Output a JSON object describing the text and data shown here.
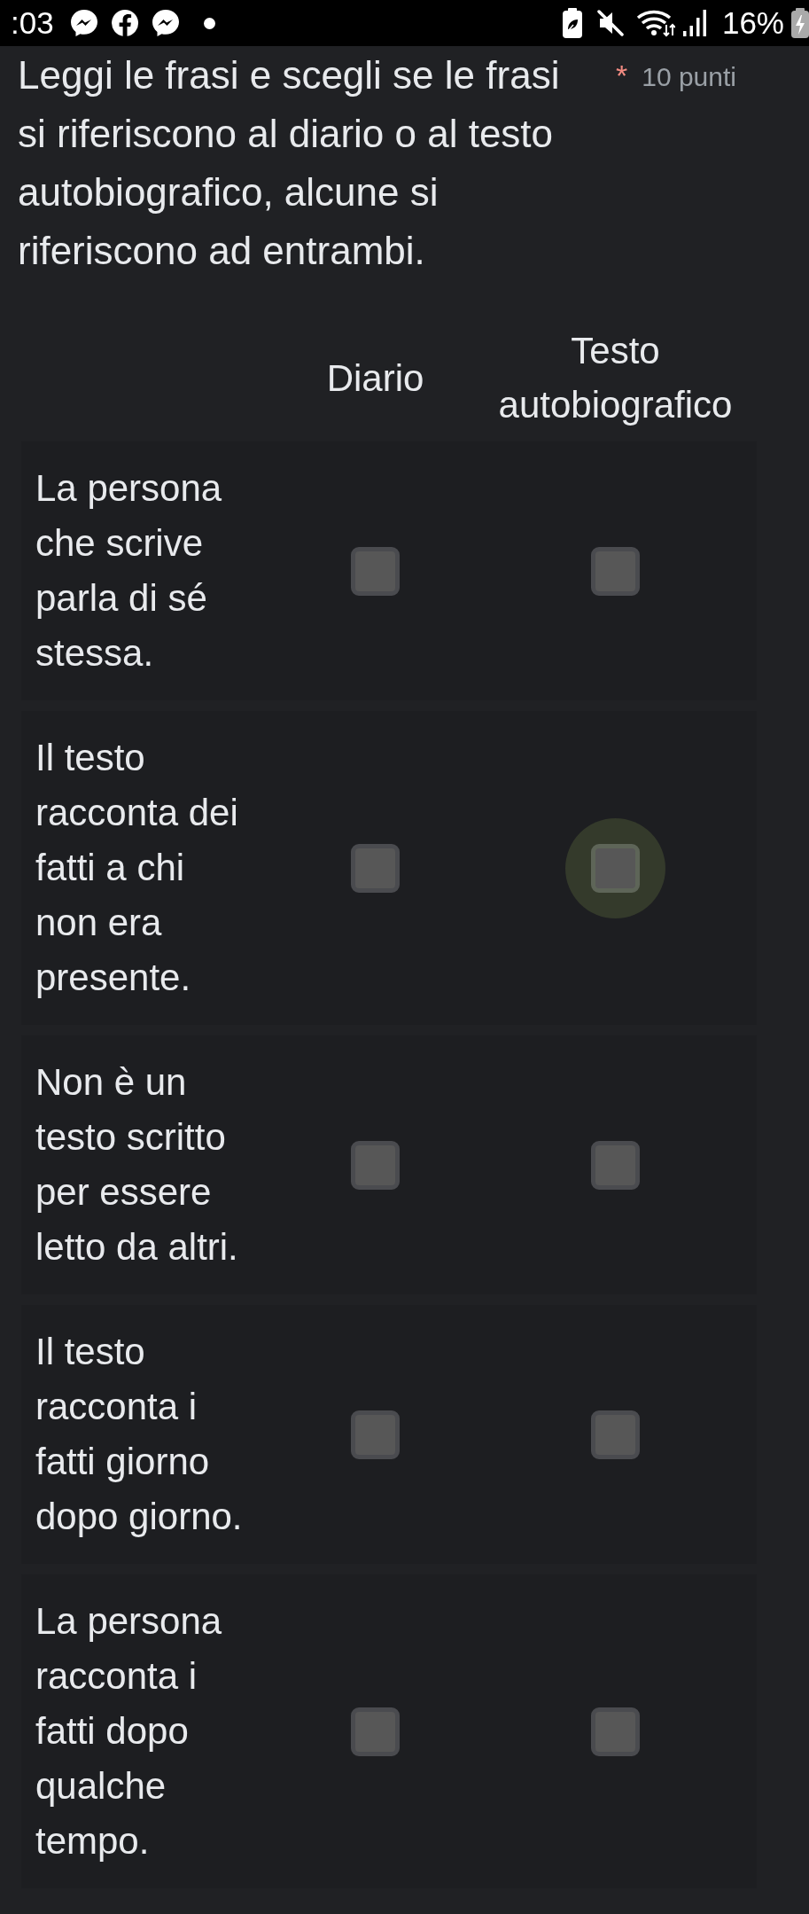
{
  "status_bar": {
    "time": ":03",
    "battery": "16%"
  },
  "question": {
    "title": "Leggi le frasi e scegli se le frasi si riferiscono al diario o al testo autobiografico, alcune si riferiscono ad entrambi.",
    "required_mark": "*",
    "points": "10 punti"
  },
  "grid": {
    "columns": [
      "Diario",
      "Testo autobiografico"
    ],
    "rows": [
      {
        "label": "La persona che scrive parla di sé stessa.",
        "cells": [
          {
            "checked": false,
            "focused": false
          },
          {
            "checked": false,
            "focused": false
          }
        ]
      },
      {
        "label": "Il testo racconta dei fatti a chi non era presente.",
        "cells": [
          {
            "checked": false,
            "focused": false
          },
          {
            "checked": false,
            "focused": true
          }
        ]
      },
      {
        "label": "Non è un testo scritto per essere letto da altri.",
        "cells": [
          {
            "checked": false,
            "focused": false
          },
          {
            "checked": false,
            "focused": false
          }
        ]
      },
      {
        "label": "Il testo racconta i fatti giorno dopo giorno.",
        "cells": [
          {
            "checked": false,
            "focused": false
          },
          {
            "checked": false,
            "focused": false
          }
        ]
      },
      {
        "label": "La persona racconta i fatti dopo qualche tempo.",
        "cells": [
          {
            "checked": false,
            "focused": false
          },
          {
            "checked": false,
            "focused": false
          }
        ]
      }
    ]
  }
}
